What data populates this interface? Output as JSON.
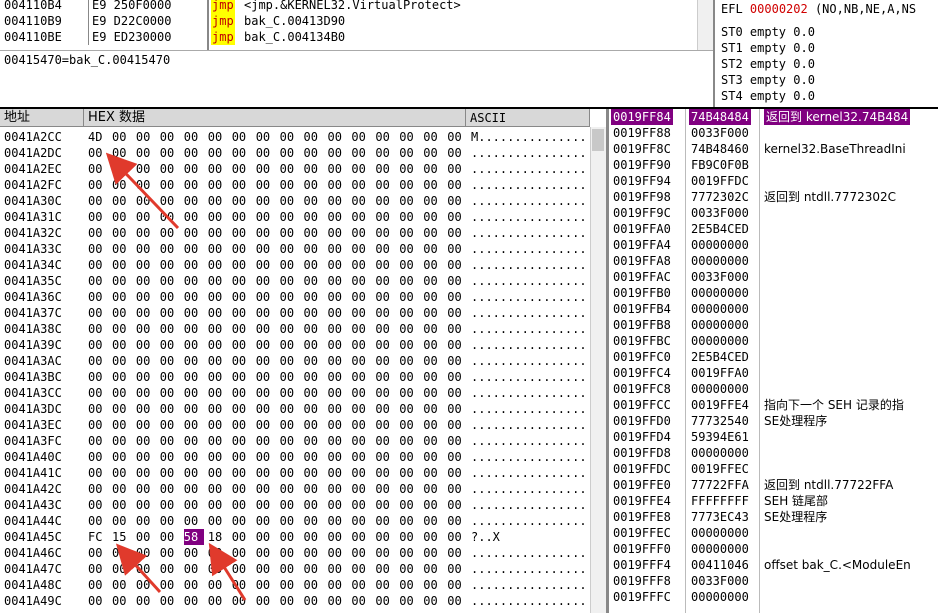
{
  "disasm": [
    {
      "addr": "004110B4",
      "hex": "E9 250F0000",
      "op": "jmp",
      "text": "<jmp.&KERNEL32.VirtualProtect>"
    },
    {
      "addr": "004110B9",
      "hex": "E9 D22C0000",
      "op": "jmp",
      "text": "bak_C.00413D90"
    },
    {
      "addr": "004110BE",
      "hex": "E9 ED230000",
      "op": "jmp",
      "text": "bak_C.004134B0"
    }
  ],
  "info_line": "00415470=bak_C.00415470",
  "registers": {
    "efl_label": "EFL",
    "efl_value": "00000202",
    "efl_flags": "(NO,NB,NE,A,NS",
    "st": [
      "ST0 empty 0.0",
      "ST1 empty 0.0",
      "ST2 empty 0.0",
      "ST3 empty 0.0",
      "ST4 empty 0.0"
    ]
  },
  "dump": {
    "headers": {
      "address": "地址",
      "hex": "HEX 数据",
      "ascii": "ASCII"
    },
    "rows": [
      {
        "addr": "0041A2CC",
        "bytes": [
          "4D",
          "00",
          "00",
          "00",
          "00",
          "00",
          "00",
          "00",
          "00",
          "00",
          "00",
          "00",
          "00",
          "00",
          "00",
          "00"
        ],
        "ascii": "M..............."
      },
      {
        "addr": "0041A2DC",
        "bytes": [
          "00",
          "00",
          "00",
          "00",
          "00",
          "00",
          "00",
          "00",
          "00",
          "00",
          "00",
          "00",
          "00",
          "00",
          "00",
          "00"
        ],
        "ascii": "................"
      },
      {
        "addr": "0041A2EC",
        "bytes": [
          "00",
          "00",
          "00",
          "00",
          "00",
          "00",
          "00",
          "00",
          "00",
          "00",
          "00",
          "00",
          "00",
          "00",
          "00",
          "00"
        ],
        "ascii": "................"
      },
      {
        "addr": "0041A2FC",
        "bytes": [
          "00",
          "00",
          "00",
          "00",
          "00",
          "00",
          "00",
          "00",
          "00",
          "00",
          "00",
          "00",
          "00",
          "00",
          "00",
          "00"
        ],
        "ascii": "................"
      },
      {
        "addr": "0041A30C",
        "bytes": [
          "00",
          "00",
          "00",
          "00",
          "00",
          "00",
          "00",
          "00",
          "00",
          "00",
          "00",
          "00",
          "00",
          "00",
          "00",
          "00"
        ],
        "ascii": "................"
      },
      {
        "addr": "0041A31C",
        "bytes": [
          "00",
          "00",
          "00",
          "00",
          "00",
          "00",
          "00",
          "00",
          "00",
          "00",
          "00",
          "00",
          "00",
          "00",
          "00",
          "00"
        ],
        "ascii": "................"
      },
      {
        "addr": "0041A32C",
        "bytes": [
          "00",
          "00",
          "00",
          "00",
          "00",
          "00",
          "00",
          "00",
          "00",
          "00",
          "00",
          "00",
          "00",
          "00",
          "00",
          "00"
        ],
        "ascii": "................"
      },
      {
        "addr": "0041A33C",
        "bytes": [
          "00",
          "00",
          "00",
          "00",
          "00",
          "00",
          "00",
          "00",
          "00",
          "00",
          "00",
          "00",
          "00",
          "00",
          "00",
          "00"
        ],
        "ascii": "................"
      },
      {
        "addr": "0041A34C",
        "bytes": [
          "00",
          "00",
          "00",
          "00",
          "00",
          "00",
          "00",
          "00",
          "00",
          "00",
          "00",
          "00",
          "00",
          "00",
          "00",
          "00"
        ],
        "ascii": "................"
      },
      {
        "addr": "0041A35C",
        "bytes": [
          "00",
          "00",
          "00",
          "00",
          "00",
          "00",
          "00",
          "00",
          "00",
          "00",
          "00",
          "00",
          "00",
          "00",
          "00",
          "00"
        ],
        "ascii": "................"
      },
      {
        "addr": "0041A36C",
        "bytes": [
          "00",
          "00",
          "00",
          "00",
          "00",
          "00",
          "00",
          "00",
          "00",
          "00",
          "00",
          "00",
          "00",
          "00",
          "00",
          "00"
        ],
        "ascii": "................"
      },
      {
        "addr": "0041A37C",
        "bytes": [
          "00",
          "00",
          "00",
          "00",
          "00",
          "00",
          "00",
          "00",
          "00",
          "00",
          "00",
          "00",
          "00",
          "00",
          "00",
          "00"
        ],
        "ascii": "................"
      },
      {
        "addr": "0041A38C",
        "bytes": [
          "00",
          "00",
          "00",
          "00",
          "00",
          "00",
          "00",
          "00",
          "00",
          "00",
          "00",
          "00",
          "00",
          "00",
          "00",
          "00"
        ],
        "ascii": "................"
      },
      {
        "addr": "0041A39C",
        "bytes": [
          "00",
          "00",
          "00",
          "00",
          "00",
          "00",
          "00",
          "00",
          "00",
          "00",
          "00",
          "00",
          "00",
          "00",
          "00",
          "00"
        ],
        "ascii": "................"
      },
      {
        "addr": "0041A3AC",
        "bytes": [
          "00",
          "00",
          "00",
          "00",
          "00",
          "00",
          "00",
          "00",
          "00",
          "00",
          "00",
          "00",
          "00",
          "00",
          "00",
          "00"
        ],
        "ascii": "................"
      },
      {
        "addr": "0041A3BC",
        "bytes": [
          "00",
          "00",
          "00",
          "00",
          "00",
          "00",
          "00",
          "00",
          "00",
          "00",
          "00",
          "00",
          "00",
          "00",
          "00",
          "00"
        ],
        "ascii": "................"
      },
      {
        "addr": "0041A3CC",
        "bytes": [
          "00",
          "00",
          "00",
          "00",
          "00",
          "00",
          "00",
          "00",
          "00",
          "00",
          "00",
          "00",
          "00",
          "00",
          "00",
          "00"
        ],
        "ascii": "................"
      },
      {
        "addr": "0041A3DC",
        "bytes": [
          "00",
          "00",
          "00",
          "00",
          "00",
          "00",
          "00",
          "00",
          "00",
          "00",
          "00",
          "00",
          "00",
          "00",
          "00",
          "00"
        ],
        "ascii": "................"
      },
      {
        "addr": "0041A3EC",
        "bytes": [
          "00",
          "00",
          "00",
          "00",
          "00",
          "00",
          "00",
          "00",
          "00",
          "00",
          "00",
          "00",
          "00",
          "00",
          "00",
          "00"
        ],
        "ascii": "................"
      },
      {
        "addr": "0041A3FC",
        "bytes": [
          "00",
          "00",
          "00",
          "00",
          "00",
          "00",
          "00",
          "00",
          "00",
          "00",
          "00",
          "00",
          "00",
          "00",
          "00",
          "00"
        ],
        "ascii": "................"
      },
      {
        "addr": "0041A40C",
        "bytes": [
          "00",
          "00",
          "00",
          "00",
          "00",
          "00",
          "00",
          "00",
          "00",
          "00",
          "00",
          "00",
          "00",
          "00",
          "00",
          "00"
        ],
        "ascii": "................"
      },
      {
        "addr": "0041A41C",
        "bytes": [
          "00",
          "00",
          "00",
          "00",
          "00",
          "00",
          "00",
          "00",
          "00",
          "00",
          "00",
          "00",
          "00",
          "00",
          "00",
          "00"
        ],
        "ascii": "................"
      },
      {
        "addr": "0041A42C",
        "bytes": [
          "00",
          "00",
          "00",
          "00",
          "00",
          "00",
          "00",
          "00",
          "00",
          "00",
          "00",
          "00",
          "00",
          "00",
          "00",
          "00"
        ],
        "ascii": "................"
      },
      {
        "addr": "0041A43C",
        "bytes": [
          "00",
          "00",
          "00",
          "00",
          "00",
          "00",
          "00",
          "00",
          "00",
          "00",
          "00",
          "00",
          "00",
          "00",
          "00",
          "00"
        ],
        "ascii": "................"
      },
      {
        "addr": "0041A44C",
        "bytes": [
          "00",
          "00",
          "00",
          "00",
          "00",
          "00",
          "00",
          "00",
          "00",
          "00",
          "00",
          "00",
          "00",
          "00",
          "00",
          "00"
        ],
        "ascii": "................"
      },
      {
        "addr": "0041A45C",
        "bytes": [
          "FC",
          "15",
          "00",
          "00",
          "58",
          "18",
          "00",
          "00",
          "00",
          "00",
          "00",
          "00",
          "00",
          "00",
          "00",
          "00"
        ],
        "ascii": "?..X",
        "ascii_hl": "█",
        "hl_index": 4
      },
      {
        "addr": "0041A46C",
        "bytes": [
          "00",
          "00",
          "00",
          "00",
          "00",
          "00",
          "00",
          "00",
          "00",
          "00",
          "00",
          "00",
          "00",
          "00",
          "00",
          "00"
        ],
        "ascii": "................"
      },
      {
        "addr": "0041A47C",
        "bytes": [
          "00",
          "00",
          "00",
          "00",
          "00",
          "00",
          "00",
          "00",
          "00",
          "00",
          "00",
          "00",
          "00",
          "00",
          "00",
          "00"
        ],
        "ascii": "................"
      },
      {
        "addr": "0041A48C",
        "bytes": [
          "00",
          "00",
          "00",
          "00",
          "00",
          "00",
          "00",
          "00",
          "00",
          "00",
          "00",
          "00",
          "00",
          "00",
          "00",
          "00"
        ],
        "ascii": "................"
      },
      {
        "addr": "0041A49C",
        "bytes": [
          "00",
          "00",
          "00",
          "00",
          "00",
          "00",
          "00",
          "00",
          "00",
          "00",
          "00",
          "00",
          "00",
          "00",
          "00",
          "00"
        ],
        "ascii": "................"
      }
    ]
  },
  "stack": [
    {
      "addr": "0019FF84",
      "val": "74B48484",
      "comment": "返回到 kernel32.74B484",
      "hl": true
    },
    {
      "addr": "0019FF88",
      "val": "0033F000",
      "comment": ""
    },
    {
      "addr": "0019FF8C",
      "val": "74B48460",
      "comment": "kernel32.BaseThreadIni"
    },
    {
      "addr": "0019FF90",
      "val": "FB9C0F0B",
      "comment": ""
    },
    {
      "addr": "0019FF94",
      "val": "0019FFDC",
      "comment": ""
    },
    {
      "addr": "0019FF98",
      "val": "7772302C",
      "comment": "返回到 ntdll.7772302C"
    },
    {
      "addr": "0019FF9C",
      "val": "0033F000",
      "comment": ""
    },
    {
      "addr": "0019FFA0",
      "val": "2E5B4CED",
      "comment": ""
    },
    {
      "addr": "0019FFA4",
      "val": "00000000",
      "comment": ""
    },
    {
      "addr": "0019FFA8",
      "val": "00000000",
      "comment": ""
    },
    {
      "addr": "0019FFAC",
      "val": "0033F000",
      "comment": ""
    },
    {
      "addr": "0019FFB0",
      "val": "00000000",
      "comment": ""
    },
    {
      "addr": "0019FFB4",
      "val": "00000000",
      "comment": ""
    },
    {
      "addr": "0019FFB8",
      "val": "00000000",
      "comment": ""
    },
    {
      "addr": "0019FFBC",
      "val": "00000000",
      "comment": ""
    },
    {
      "addr": "0019FFC0",
      "val": "2E5B4CED",
      "comment": ""
    },
    {
      "addr": "0019FFC4",
      "val": "0019FFA0",
      "comment": ""
    },
    {
      "addr": "0019FFC8",
      "val": "00000000",
      "comment": ""
    },
    {
      "addr": "0019FFCC",
      "val": "0019FFE4",
      "comment": "指向下一个 SEH 记录的指"
    },
    {
      "addr": "0019FFD0",
      "val": "77732540",
      "comment": "SE处理程序"
    },
    {
      "addr": "0019FFD4",
      "val": "59394E61",
      "comment": ""
    },
    {
      "addr": "0019FFD8",
      "val": "00000000",
      "comment": ""
    },
    {
      "addr": "0019FFDC",
      "val": "0019FFEC",
      "comment": ""
    },
    {
      "addr": "0019FFE0",
      "val": "77722FFA",
      "comment": "返回到 ntdll.77722FFA"
    },
    {
      "addr": "0019FFE4",
      "val": "FFFFFFFF",
      "comment": "SEH 链尾部"
    },
    {
      "addr": "0019FFE8",
      "val": "7773EC43",
      "comment": "SE处理程序"
    },
    {
      "addr": "0019FFEC",
      "val": "00000000",
      "comment": ""
    },
    {
      "addr": "0019FFF0",
      "val": "00000000",
      "comment": ""
    },
    {
      "addr": "0019FFF4",
      "val": "00411046",
      "comment": "offset bak_C.<ModuleEn"
    },
    {
      "addr": "0019FFF8",
      "val": "0033F000",
      "comment": ""
    },
    {
      "addr": "0019FFFC",
      "val": "00000000",
      "comment": ""
    }
  ],
  "colors": {
    "highlight": "#800080",
    "arrow": "#e03a2c",
    "jmp_bg": "#ffff00",
    "jmp_fg": "#c00000",
    "efl": "#d00000"
  }
}
